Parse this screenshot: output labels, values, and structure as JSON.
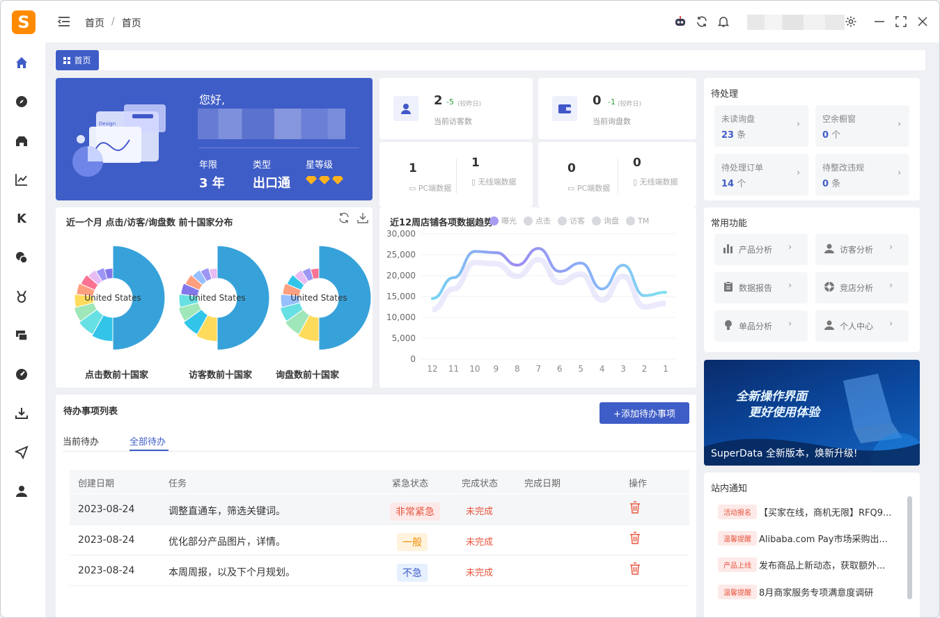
{
  "breadcrumb": {
    "home": "首页",
    "sep": "/",
    "current": "首页"
  },
  "tab": {
    "label": "首页"
  },
  "welcome": {
    "greeting": "您好,",
    "years_label": "年限",
    "years_value": "3 年",
    "type_label": "类型",
    "type_value": "出口通",
    "star_label": "星等级",
    "illustration_word": "Design"
  },
  "stats": [
    {
      "value": "2",
      "delta": "-5",
      "delta_note": "(较昨日)",
      "label": "当前访客数",
      "sub": [
        {
          "value": "1",
          "label": "PC端数据"
        },
        {
          "value": "1",
          "label": "无线端数据"
        }
      ]
    },
    {
      "value": "0",
      "delta": "-1",
      "delta_note": "(较昨日)",
      "label": "当前询盘数",
      "sub": [
        {
          "value": "0",
          "label": "PC端数据"
        },
        {
          "value": "0",
          "label": "无线端数据"
        }
      ]
    }
  ],
  "pending": {
    "title": "待处理",
    "items": [
      {
        "label": "未读询盘",
        "value": "23",
        "unit": "条"
      },
      {
        "label": "空余橱窗",
        "value": "0",
        "unit": "个"
      },
      {
        "label": "待处理订单",
        "value": "14",
        "unit": "个"
      },
      {
        "label": "待整改违规",
        "value": "0",
        "unit": "条"
      }
    ]
  },
  "donut_card": {
    "title": "近一个月 点击/访客/询盘数 前十国家分布",
    "center_label": "United States",
    "captions": [
      "点击数前十国家",
      "访客数前十国家",
      "询盘数前十国家"
    ]
  },
  "trend_card": {
    "title": "近12周店铺各项数据趋势"
  },
  "chart_data": {
    "type": "line",
    "x": [
      "12",
      "11",
      "10",
      "9",
      "8",
      "7",
      "6",
      "5",
      "4",
      "3",
      "2",
      "1"
    ],
    "ylim": [
      0,
      30000
    ],
    "yticks": [
      "30,000",
      "25,000",
      "20,000",
      "15,000",
      "10,000",
      "5,000",
      "0"
    ],
    "legend": [
      "曝光",
      "点击",
      "访客",
      "询盘",
      "TM"
    ],
    "series": [
      {
        "name": "曝光",
        "values": [
          14500,
          19500,
          25800,
          25500,
          22500,
          26500,
          21000,
          23000,
          16800,
          22500,
          15200,
          16000
        ]
      }
    ]
  },
  "functions": {
    "title": "常用功能",
    "items": [
      {
        "label": "产品分析",
        "icon": "bar-chart-icon"
      },
      {
        "label": "访客分析",
        "icon": "user-icon"
      },
      {
        "label": "数据报告",
        "icon": "clipboard-icon"
      },
      {
        "label": "竞店分析",
        "icon": "compass-icon"
      },
      {
        "label": "单品分析",
        "icon": "bulb-icon"
      },
      {
        "label": "个人中心",
        "icon": "person-icon"
      }
    ]
  },
  "banner": {
    "line1": "全新操作界面",
    "line2": "更好使用体验",
    "caption": "SuperData 全新版本，焕新升级!"
  },
  "todo": {
    "title": "待办事项列表",
    "add_button": "+添加待办事项",
    "tabs": [
      "当前待办",
      "全部待办"
    ],
    "columns": [
      "创建日期",
      "任务",
      "紧急状态",
      "完成状态",
      "完成日期",
      "操作"
    ],
    "rows": [
      {
        "date": "2023-08-24",
        "task": "调整直通车，筛选关键词。",
        "urgency": "非常紧急",
        "status": "未完成"
      },
      {
        "date": "2023-08-24",
        "task": "优化部分产品图片，详情。",
        "urgency": "一般",
        "status": "未完成"
      },
      {
        "date": "2023-08-24",
        "task": "本周周报，以及下个月规划。",
        "urgency": "不急",
        "status": "未完成"
      }
    ]
  },
  "notices": {
    "title": "站内通知",
    "items": [
      {
        "tag": "活动报名",
        "text": "【买家在线，商机无限】RFQ9..."
      },
      {
        "tag": "温馨提醒",
        "text": "Alibaba.com Pay市场采购出..."
      },
      {
        "tag": "产品上线",
        "text": "发布商品上新动态，获取额外..."
      },
      {
        "tag": "温馨提醒",
        "text": "8月商家服务专项满意度调研"
      }
    ]
  },
  "colors": {
    "primary": "#3f5dc7",
    "accent_orange": "#ff8a00",
    "danger": "#e8553e"
  }
}
